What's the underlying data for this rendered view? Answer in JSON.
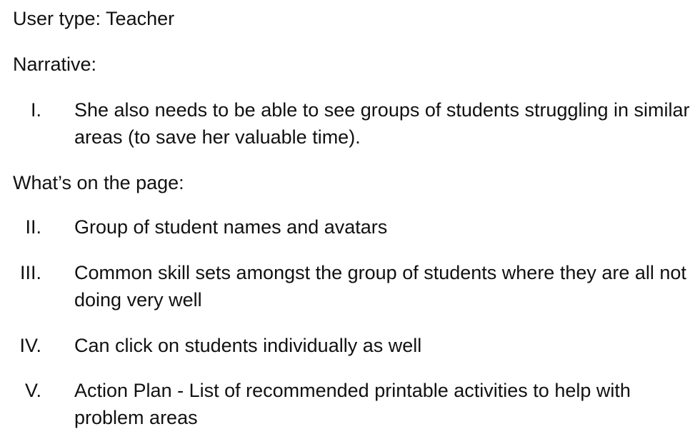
{
  "document": {
    "user_type": "User type: Teacher",
    "narrative_heading": "Narrative:",
    "narrative_items": [
      {
        "numeral": "I.",
        "text": "She also needs to be able to see groups of students struggling in similar areas (to save her valuable time)."
      }
    ],
    "page_heading": "What’s on the page:",
    "page_items": [
      {
        "numeral": "II.",
        "text": "Group of student names and avatars"
      },
      {
        "numeral": "III.",
        "text": "Common skill sets amongst the group of students where they are all not doing very well"
      },
      {
        "numeral": "IV.",
        "text": "Can click on students individually as well"
      },
      {
        "numeral": "V.",
        "text": "Action Plan -  List of recommended printable activities to help with problem areas"
      }
    ]
  }
}
